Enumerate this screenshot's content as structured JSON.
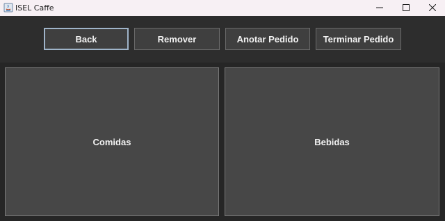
{
  "window": {
    "title": "ISEL Caffe",
    "icon": "java-app-icon"
  },
  "titlebar_controls": {
    "minimize_icon": "minimize-icon",
    "maximize_icon": "maximize-icon",
    "close_icon": "close-icon"
  },
  "toolbar": {
    "back_label": "Back",
    "remover_label": "Remover",
    "anotar_label": "Anotar Pedido",
    "terminar_label": "Terminar Pedido"
  },
  "panels": {
    "comidas_label": "Comidas",
    "bebidas_label": "Bebidas"
  },
  "colors": {
    "background": "#2b2b2b",
    "button": "#3f3f3f",
    "panel": "#474747",
    "focus_border": "#9fb4c9",
    "titlebar": "#f7f0f4"
  }
}
